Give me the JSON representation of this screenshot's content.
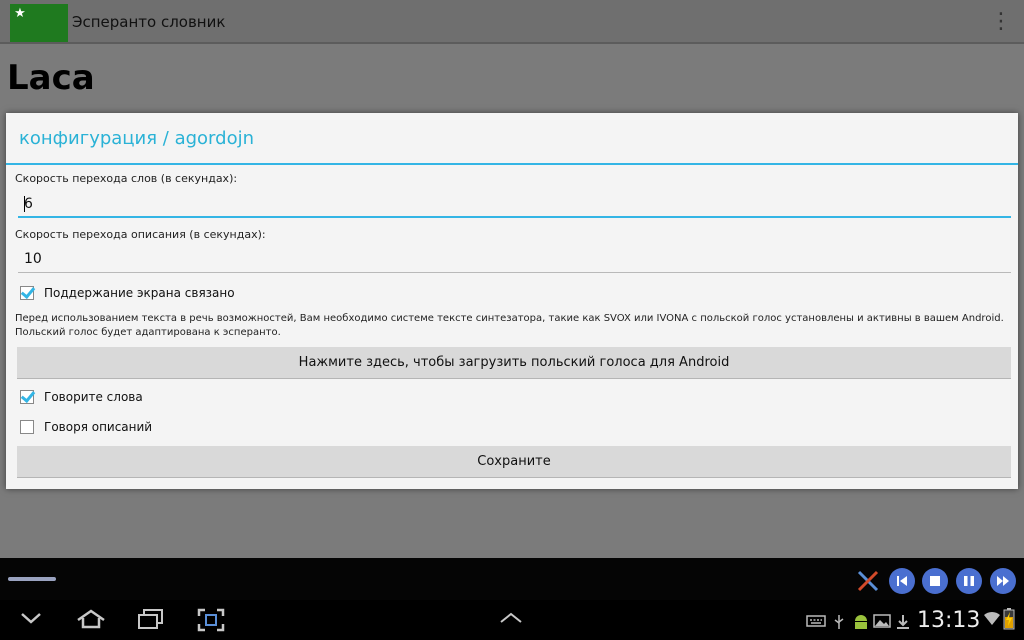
{
  "app": {
    "title": "Эсперанто словник",
    "flag_star": "★",
    "overflow_glyph": "⋮",
    "word": "Laca"
  },
  "dialog": {
    "title": "конфигурация / agordojn",
    "word_speed": {
      "label": "Скорость перехода слов (в секундах):",
      "value": "6"
    },
    "desc_speed": {
      "label": "Скорость перехода описания (в секундах):",
      "value": "10"
    },
    "keep_screen": {
      "label": "Поддержание экрана связано",
      "checked": true
    },
    "info_text": "Перед использованием текста в речь возможностей, Вам необходимо системе тексте синтезатора, такие как SVOX или IVONA с польской голос установлены и активны в вашем Android. Польский голос будет адаптирована к эсперанто.",
    "download_button": "Нажмите здесь, чтобы загрузить польский голоса для Android",
    "speak_words": {
      "label": "Говорите слова",
      "checked": true
    },
    "speak_desc": {
      "label": "Говоря описаний",
      "checked": false
    },
    "save_button": "Сохраните"
  },
  "system": {
    "clock": "13:13"
  },
  "colors": {
    "accent": "#33b5e5",
    "flag_green": "#1f7a1f"
  }
}
